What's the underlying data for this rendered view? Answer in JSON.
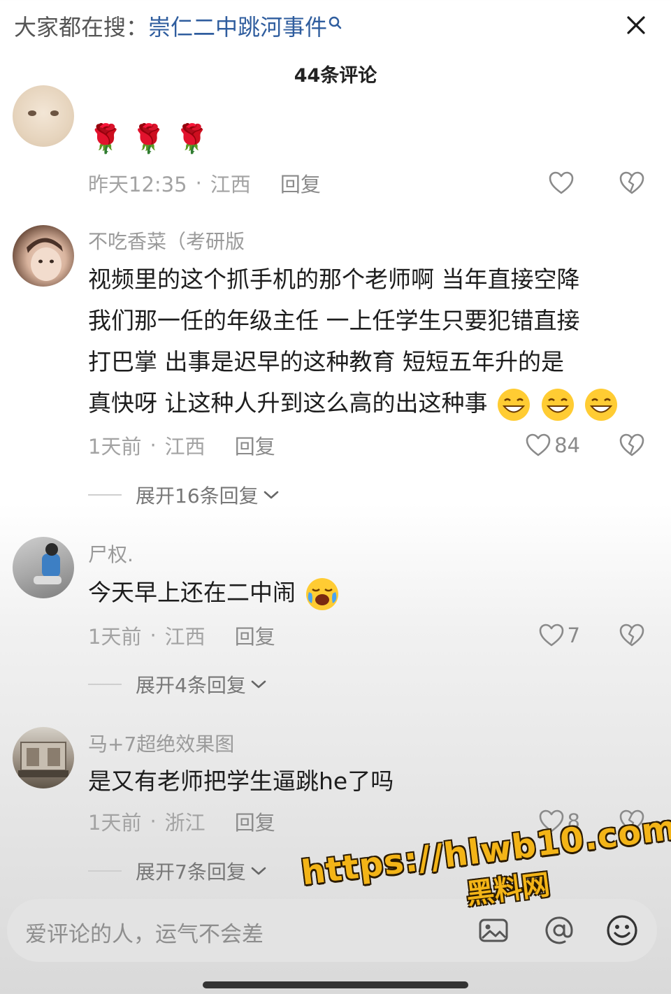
{
  "header": {
    "search_prefix": "大家都在搜：",
    "search_query": "崇仁二中跳河事件",
    "comment_count_label": "44条评论"
  },
  "icons": {
    "close": "close-icon",
    "search": "search-icon",
    "like": "heart-outline-icon",
    "dislike": "broken-heart-icon",
    "expand": "chevron-down-icon",
    "image": "image-icon",
    "mention": "at-sign-icon",
    "emoji": "smiley-icon"
  },
  "colors": {
    "link_blue": "#2f5d9e",
    "meta_gray": "#a3a3a3",
    "watermark_yellow": "#f3b417"
  },
  "comments": [
    {
      "username": "",
      "content": "🌹🌹🌹",
      "time": "昨天12:35",
      "location": "江西",
      "reply_label": "回复",
      "likes": "",
      "expand_label": ""
    },
    {
      "username": "不吃香菜（考研版",
      "content_lines": [
        "视频里的这个抓手机的那个老师啊 当年直接空降",
        "我们那一任的年级主任  一上任学生只要犯错直接",
        "打巴掌  出事是迟早的这种教育  短短五年升的是",
        "真快呀 让这种人升到这么高的出这种事"
      ],
      "time": "1天前",
      "location": "江西",
      "reply_label": "回复",
      "likes": "84",
      "expand_label": "展开16条回复"
    },
    {
      "username": "尸权.",
      "content": "今天早上还在二中闹",
      "time": "1天前",
      "location": "江西",
      "reply_label": "回复",
      "likes": "7",
      "expand_label": "展开4条回复"
    },
    {
      "username": "马+7超绝效果图",
      "content": "是又有老师把学生逼跳he了吗",
      "time": "1天前",
      "location": "浙江",
      "reply_label": "回复",
      "likes": "8",
      "expand_label": "展开7条回复"
    }
  ],
  "input": {
    "placeholder": "爱评论的人，运气不会差"
  },
  "watermark": {
    "url": "https://hlwb10.com",
    "site_name": "黑料网"
  }
}
